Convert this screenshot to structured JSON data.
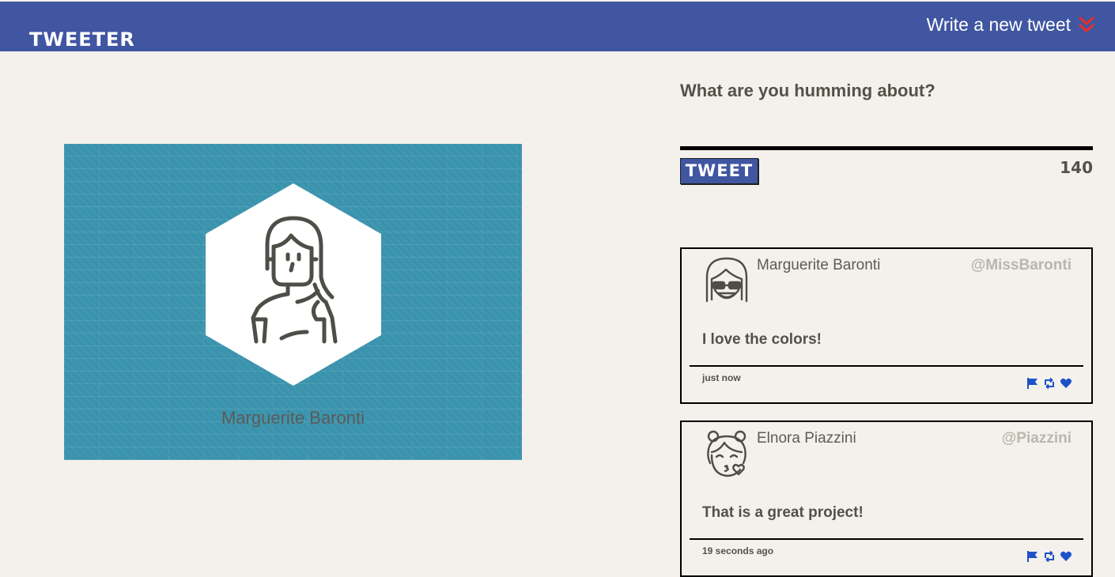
{
  "nav": {
    "brand": "TWEETER",
    "write_label": "Write a new tweet"
  },
  "profile": {
    "name": "Marguerite Baronti"
  },
  "compose": {
    "question": "What are you humming about?",
    "input_value": "",
    "tweet_button": "TWEET",
    "counter": "140"
  },
  "tweets": [
    {
      "name": "Marguerite Baronti",
      "handle": "@MissBaronti",
      "text": "I love the colors!",
      "time": "just now"
    },
    {
      "name": "Elnora Piazzini",
      "handle": "@Piazzini",
      "text": "That is a great project!",
      "time": "19 seconds ago"
    }
  ],
  "colors": {
    "nav": "#4056a1",
    "background": "#f4f1ec",
    "profile_bg": "#3d96b0",
    "accent_red": "#e02f2f",
    "action_blue": "#1e52c8",
    "text": "#545149",
    "handle": "#bab6ad"
  },
  "icons": {
    "write_toggle": "double-chevron-down-icon",
    "flag": "flag-icon",
    "retweet": "retweet-icon",
    "like": "heart-icon"
  }
}
